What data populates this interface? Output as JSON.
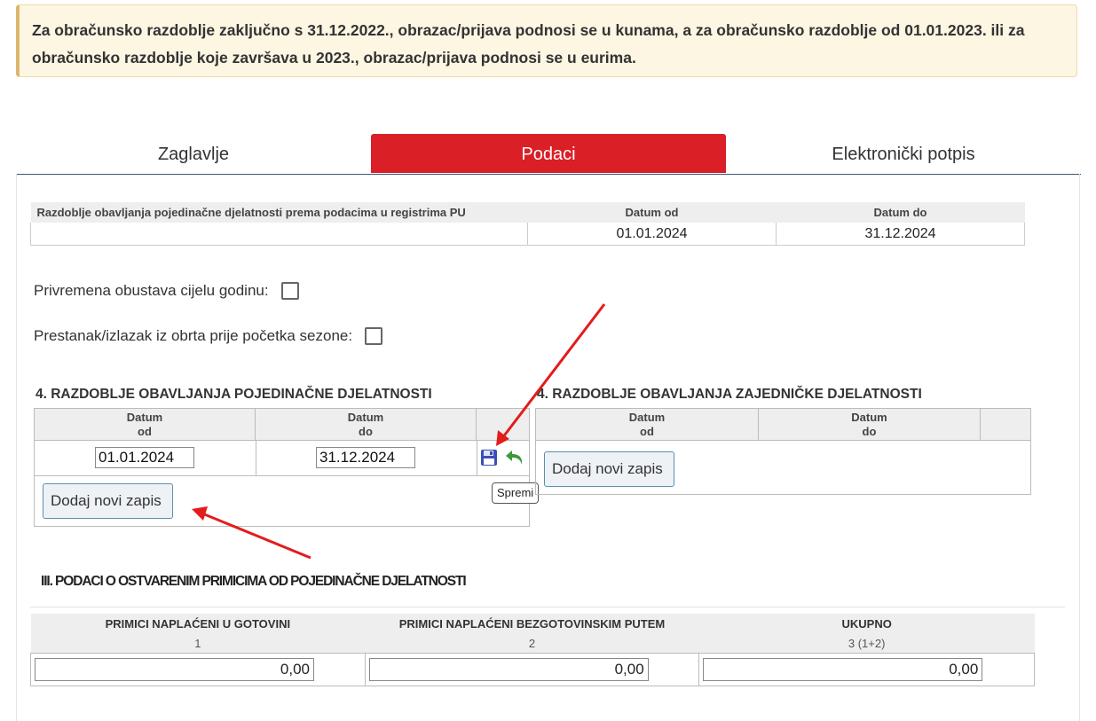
{
  "notice": "Za obračunsko razdoblje zaključno s 31.12.2022., obrazac/prijava podnosi se u kunama, a za obračunsko razdoblje od 01.01.2023. ili za obračunsko razdoblje koje završava u 2023., obrazac/prijava podnosi se u eurima.",
  "tabs": [
    {
      "label": "Zaglavlje"
    },
    {
      "label": "Podaci"
    },
    {
      "label": "Elektronički potpis"
    }
  ],
  "period_table": {
    "col1": "Razdoblje obavljanja pojedinačne djelatnosti prema podacima u registrima PU",
    "col2": "Datum od",
    "col3": "Datum do",
    "row": {
      "desc": "",
      "from": "01.01.2024",
      "to": "31.12.2024"
    }
  },
  "checkboxes": {
    "suspension": "Privremena obustava cijelu godinu:",
    "termination": "Prestanak/izlazak iz obrta prije početka sezone:"
  },
  "individual": {
    "title": "4. RAZDOBLJE OBAVLJANJA POJEDINAČNE DJELATNOSTI",
    "col_from_1": "Datum",
    "col_from_2": "od",
    "col_to_1": "Datum",
    "col_to_2": "do",
    "row_from": "01.01.2024",
    "row_to": "31.12.2024",
    "add_button": "Dodaj novi zapis",
    "tooltip": "Spremi"
  },
  "joint": {
    "title": "4. RAZDOBLJE OBAVLJANJA ZAJEDNIČKE DJELATNOSTI",
    "col_from_1": "Datum",
    "col_from_2": "od",
    "col_to_1": "Datum",
    "col_to_2": "do",
    "add_button": "Dodaj novi zapis"
  },
  "income": {
    "title": "III. PODACI O OSTVARENIM PRIMICIMA OD POJEDINAČNE DJELATNOSTI",
    "columns": [
      {
        "header": "PRIMICI NAPLAĆENI U GOTOVINI",
        "num": "1",
        "value": "0,00"
      },
      {
        "header": "PRIMICI NAPLAĆENI BEZGOTOVINSKIM PUTEM",
        "num": "2",
        "value": "0,00"
      },
      {
        "header": "UKUPNO",
        "num": "3 (1+2)",
        "value": "0,00"
      }
    ]
  },
  "colors": {
    "active_tab": "#da1f26",
    "arrow": "#e31c1c",
    "save_icon": "#3a4fb5",
    "undo_icon": "#3a9a3a"
  }
}
